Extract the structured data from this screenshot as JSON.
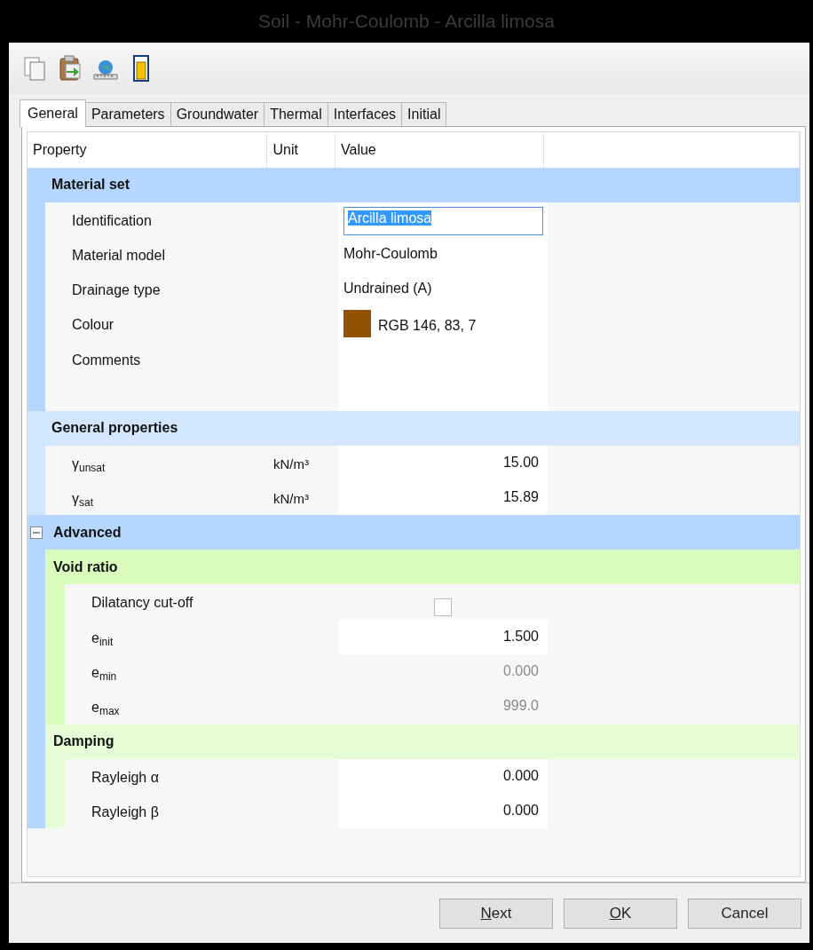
{
  "window": {
    "title": "Soil - Mohr-Coulomb - Arcilla limosa"
  },
  "toolbar": [
    {
      "kind": "copy"
    },
    {
      "kind": "paste"
    },
    {
      "kind": "globe"
    },
    {
      "kind": "cylinder"
    }
  ],
  "tabs": [
    {
      "label": "General",
      "selected": true
    },
    {
      "label": "Parameters",
      "selected": false
    },
    {
      "label": "Groundwater",
      "selected": false
    },
    {
      "label": "Thermal",
      "selected": false
    },
    {
      "label": "Interfaces",
      "selected": false
    },
    {
      "label": "Initial",
      "selected": false
    }
  ],
  "grid": {
    "columns": [
      "Property",
      "Unit",
      "Value"
    ],
    "groups": [
      {
        "title": "Material set",
        "selected": true,
        "rows": [
          {
            "kind": "input",
            "property": "Identification",
            "value": "Arcilla limosa",
            "text_selected": true
          },
          {
            "kind": "text",
            "property": "Material model",
            "value": "Mohr-Coulomb"
          },
          {
            "kind": "text",
            "property": "Drainage type",
            "value": "Undrained (A)"
          },
          {
            "kind": "color",
            "property": "Colour",
            "value": "RGB 146, 83, 7",
            "color": "#925307"
          },
          {
            "kind": "memo",
            "property": "Comments"
          }
        ]
      },
      {
        "title": "General properties",
        "selected": false,
        "rows": [
          {
            "kind": "number",
            "property": "γ$_{unsat}$",
            "unit": "kN/m³",
            "value": "15.00",
            "disabled": false
          },
          {
            "kind": "number",
            "property": "γ$_{sat}$",
            "unit": "kN/m³",
            "value": "15.89",
            "disabled": false
          }
        ]
      },
      {
        "title": "Advanced",
        "selected": true,
        "expanded": true,
        "children": [
          {
            "title": "Void ratio",
            "selected": true,
            "rows": [
              {
                "kind": "checkbox",
                "property": "Dilatancy cut-off",
                "checked": false
              },
              {
                "kind": "number",
                "property": "e$_{init}$",
                "value": "1.500",
                "disabled": false
              },
              {
                "kind": "number",
                "property": "e$_{min}$",
                "value": "0.000",
                "disabled": true
              },
              {
                "kind": "number",
                "property": "e$_{max}$",
                "value": "999.0",
                "disabled": true
              }
            ]
          },
          {
            "title": "Damping",
            "selected": false,
            "rows": [
              {
                "kind": "number",
                "property": "Rayleigh α",
                "value": "0.000",
                "disabled": false
              },
              {
                "kind": "number",
                "property": "Rayleigh β",
                "value": "0.000",
                "disabled": false
              }
            ]
          }
        ]
      }
    ]
  },
  "buttons": [
    {
      "label": "Next",
      "mnemonic": true
    },
    {
      "label": "OK",
      "mnemonic": true
    },
    {
      "label": "Cancel",
      "mnemonic": false
    }
  ]
}
